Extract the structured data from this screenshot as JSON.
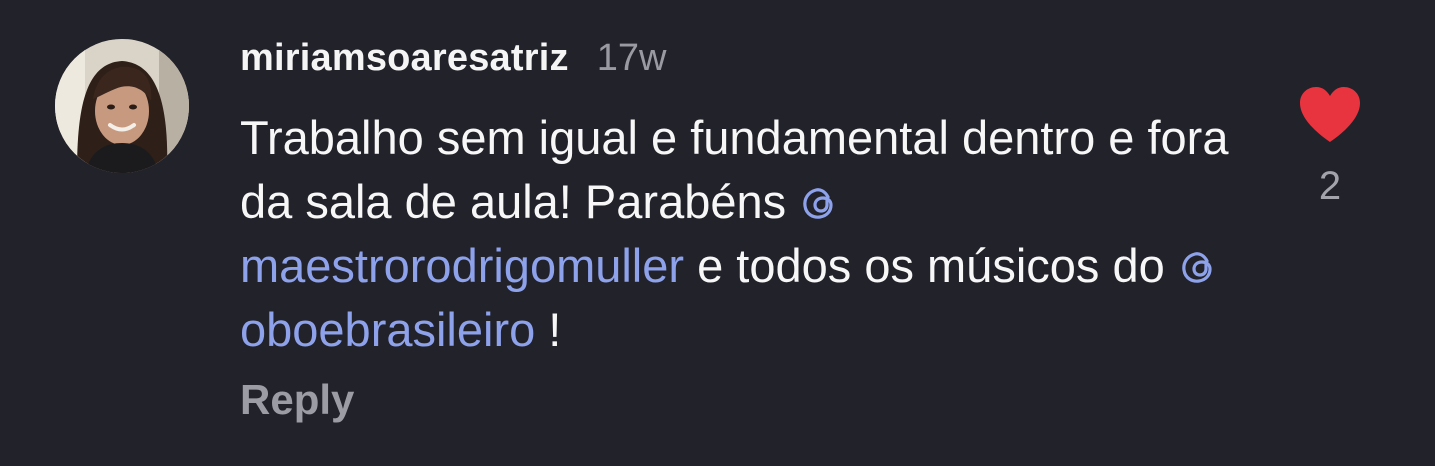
{
  "comment": {
    "username": "miriamsoaresatriz",
    "timestamp": "17w",
    "text_part1": "Trabalho sem igual e fundamental dentro e fora da sala de aula! Parabéns ",
    "mention1": "maestrorodrigomuller",
    "text_part2": " e todos os músicos do ",
    "mention2": "oboebrasileiro",
    "text_part3": " !",
    "reply_label": "Reply",
    "like_count": "2",
    "like_icon": "heart-icon",
    "mention_icon": "threads-at-icon"
  },
  "colors": {
    "background": "#22222a",
    "text": "#f7f7f7",
    "secondary": "#9a9aa2",
    "mention": "#8ea2ec",
    "like": "#e8343f"
  }
}
